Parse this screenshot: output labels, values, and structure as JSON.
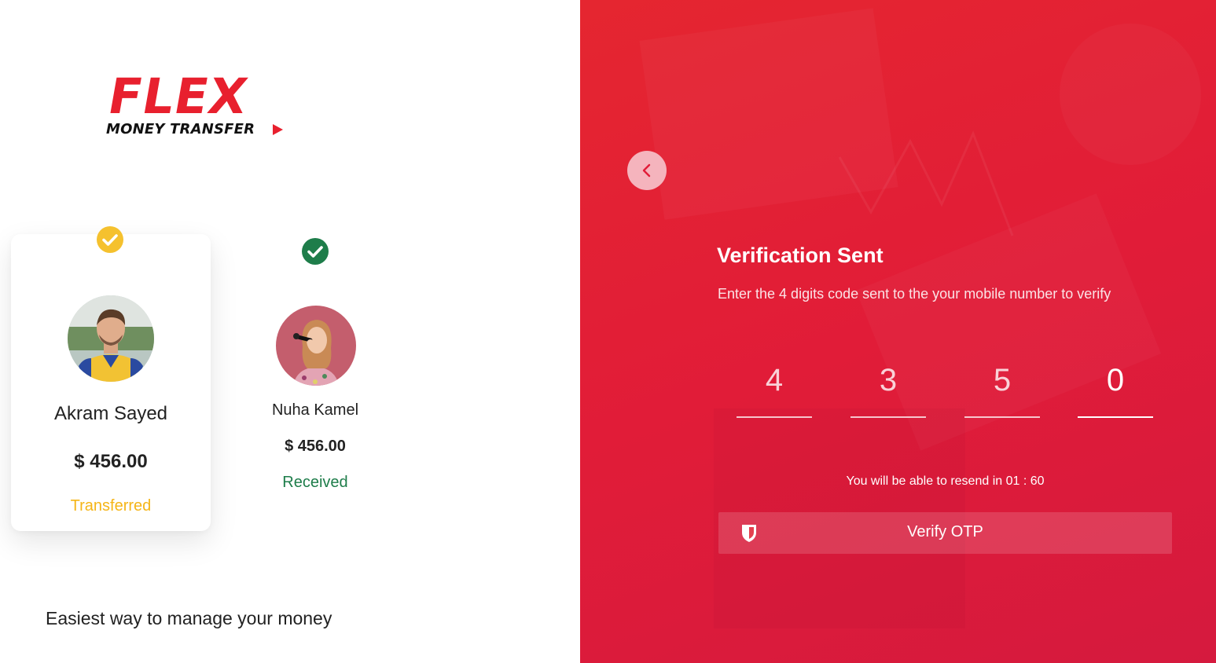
{
  "brand": {
    "logo_main": "FLEX",
    "logo_sub": "MONEY TRANSFER",
    "accent_color": "#e8202e"
  },
  "cards": [
    {
      "name": "Akram Sayed",
      "amount": "$ 456.00",
      "status": "Transferred",
      "status_color": "#f5b517",
      "check_color": "#f5c12e",
      "check_icon": "check-circle-icon"
    },
    {
      "name": "Nuha Kamel",
      "amount": "$ 456.00",
      "status": "Received",
      "status_color": "#1e7d4a",
      "check_color": "#1e7d4a",
      "check_icon": "check-circle-icon"
    }
  ],
  "tagline": "Easiest way to manage your money",
  "verification": {
    "back_icon": "chevron-left-icon",
    "title": "Verification Sent",
    "subtitle": "Enter the 4 digits code sent to the your mobile number to verify",
    "otp_digits": [
      "4",
      "3",
      "5",
      "0"
    ],
    "resend_text": "You will be able to resend in 01 : 60",
    "verify_label": "Verify OTP",
    "verify_icon": "shield-icon",
    "panel_color": "#e11c38"
  }
}
